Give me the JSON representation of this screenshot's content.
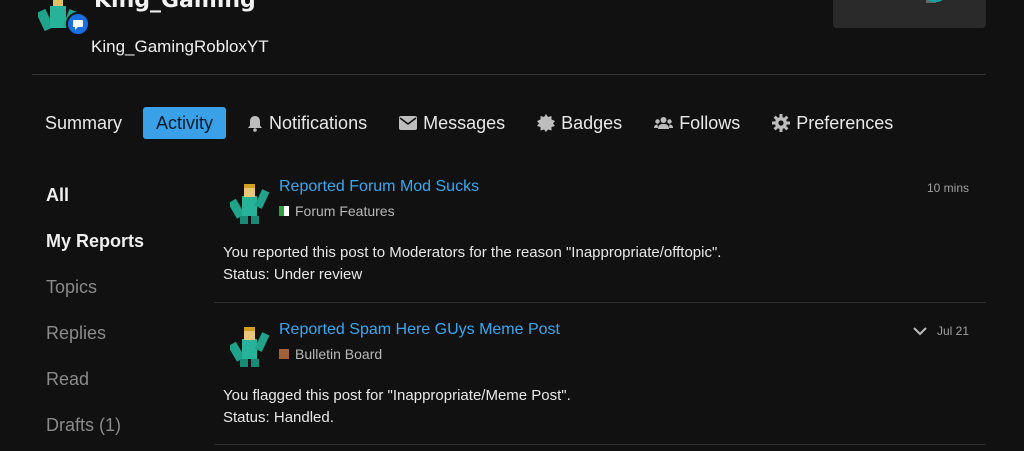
{
  "header": {
    "top_name": "King_Gaming",
    "username": "King_GamingRobloxYT"
  },
  "nav": {
    "tabs": [
      {
        "label": "Summary",
        "icon": null,
        "active": false
      },
      {
        "label": "Activity",
        "icon": null,
        "active": true
      },
      {
        "label": "Notifications",
        "icon": "bell-icon",
        "active": false
      },
      {
        "label": "Messages",
        "icon": "envelope-icon",
        "active": false
      },
      {
        "label": "Badges",
        "icon": "badge-icon",
        "active": false
      },
      {
        "label": "Follows",
        "icon": "users-icon",
        "active": false
      },
      {
        "label": "Preferences",
        "icon": "gear-icon",
        "active": false
      }
    ],
    "accent_color": "#3aa0e8"
  },
  "sidebar": {
    "items": [
      {
        "label": "All",
        "strong": true
      },
      {
        "label": "My Reports",
        "strong": true
      },
      {
        "label": "Topics",
        "strong": false
      },
      {
        "label": "Replies",
        "strong": false
      },
      {
        "label": "Read",
        "strong": false
      },
      {
        "label": "Drafts (1)",
        "strong": false
      }
    ]
  },
  "posts": [
    {
      "title": "Reported Forum Mod Sucks",
      "category": "Forum Features",
      "category_color": "#2ea043",
      "time": "10 mins",
      "body_line1": "You reported this post to Moderators for the reason \"Inappropriate/offtopic\".",
      "body_line2": "Status: Under review"
    },
    {
      "title": "Reported Spam Here GUys Meme Post",
      "category": "Bulletin Board",
      "category_color": "#a0603a",
      "time": "Jul 21",
      "body_line1": "You flagged this post for \"Inappropriate/Meme Post\".",
      "body_line2": "Status: Handled."
    }
  ]
}
